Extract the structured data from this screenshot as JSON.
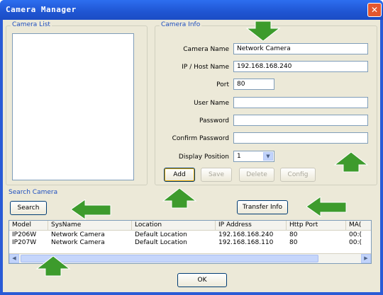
{
  "window": {
    "title": "Camera Manager",
    "close_glyph": "✕"
  },
  "camera_list": {
    "title": "Camera List"
  },
  "camera_info": {
    "title": "Camera Info",
    "camera_name_label": "Camera Name",
    "camera_name_value": "Network Camera",
    "ip_host_label": "IP / Host Name",
    "ip_host_value": "192.168.168.240",
    "port_label": "Port",
    "port_value": "80",
    "user_name_label": "User Name",
    "user_name_value": "",
    "password_label": "Password",
    "password_value": "",
    "confirm_password_label": "Confirm Password",
    "confirm_password_value": "",
    "display_position_label": "Display Position",
    "display_position_value": "1",
    "dropdown_glyph": "▼"
  },
  "buttons": {
    "add": "Add",
    "save": "Save",
    "delete": "Delete",
    "config": "Config",
    "search": "Search",
    "transfer_info": "Transfer Info",
    "ok": "OK"
  },
  "search_camera": {
    "title": "Search Camera",
    "columns": [
      "Model",
      "SysName",
      "Location",
      "IP Address",
      "Http Port",
      "MA("
    ],
    "rows": [
      [
        "IP206W",
        "Network Camera",
        "Default Location",
        "192.168.168.240",
        "80",
        "00:("
      ],
      [
        "IP207W",
        "Network Camera",
        "Default Location",
        "192.168.168.110",
        "80",
        "00:("
      ]
    ],
    "scroll_left_glyph": "◀",
    "scroll_right_glyph": "▶"
  },
  "annotation_arrows": {
    "color": "#3d9b2c",
    "items": [
      "arrow-down-icon",
      "arrow-up-icon",
      "arrow-up-icon",
      "arrow-left-icon",
      "arrow-left-icon",
      "arrow-up-icon"
    ]
  }
}
